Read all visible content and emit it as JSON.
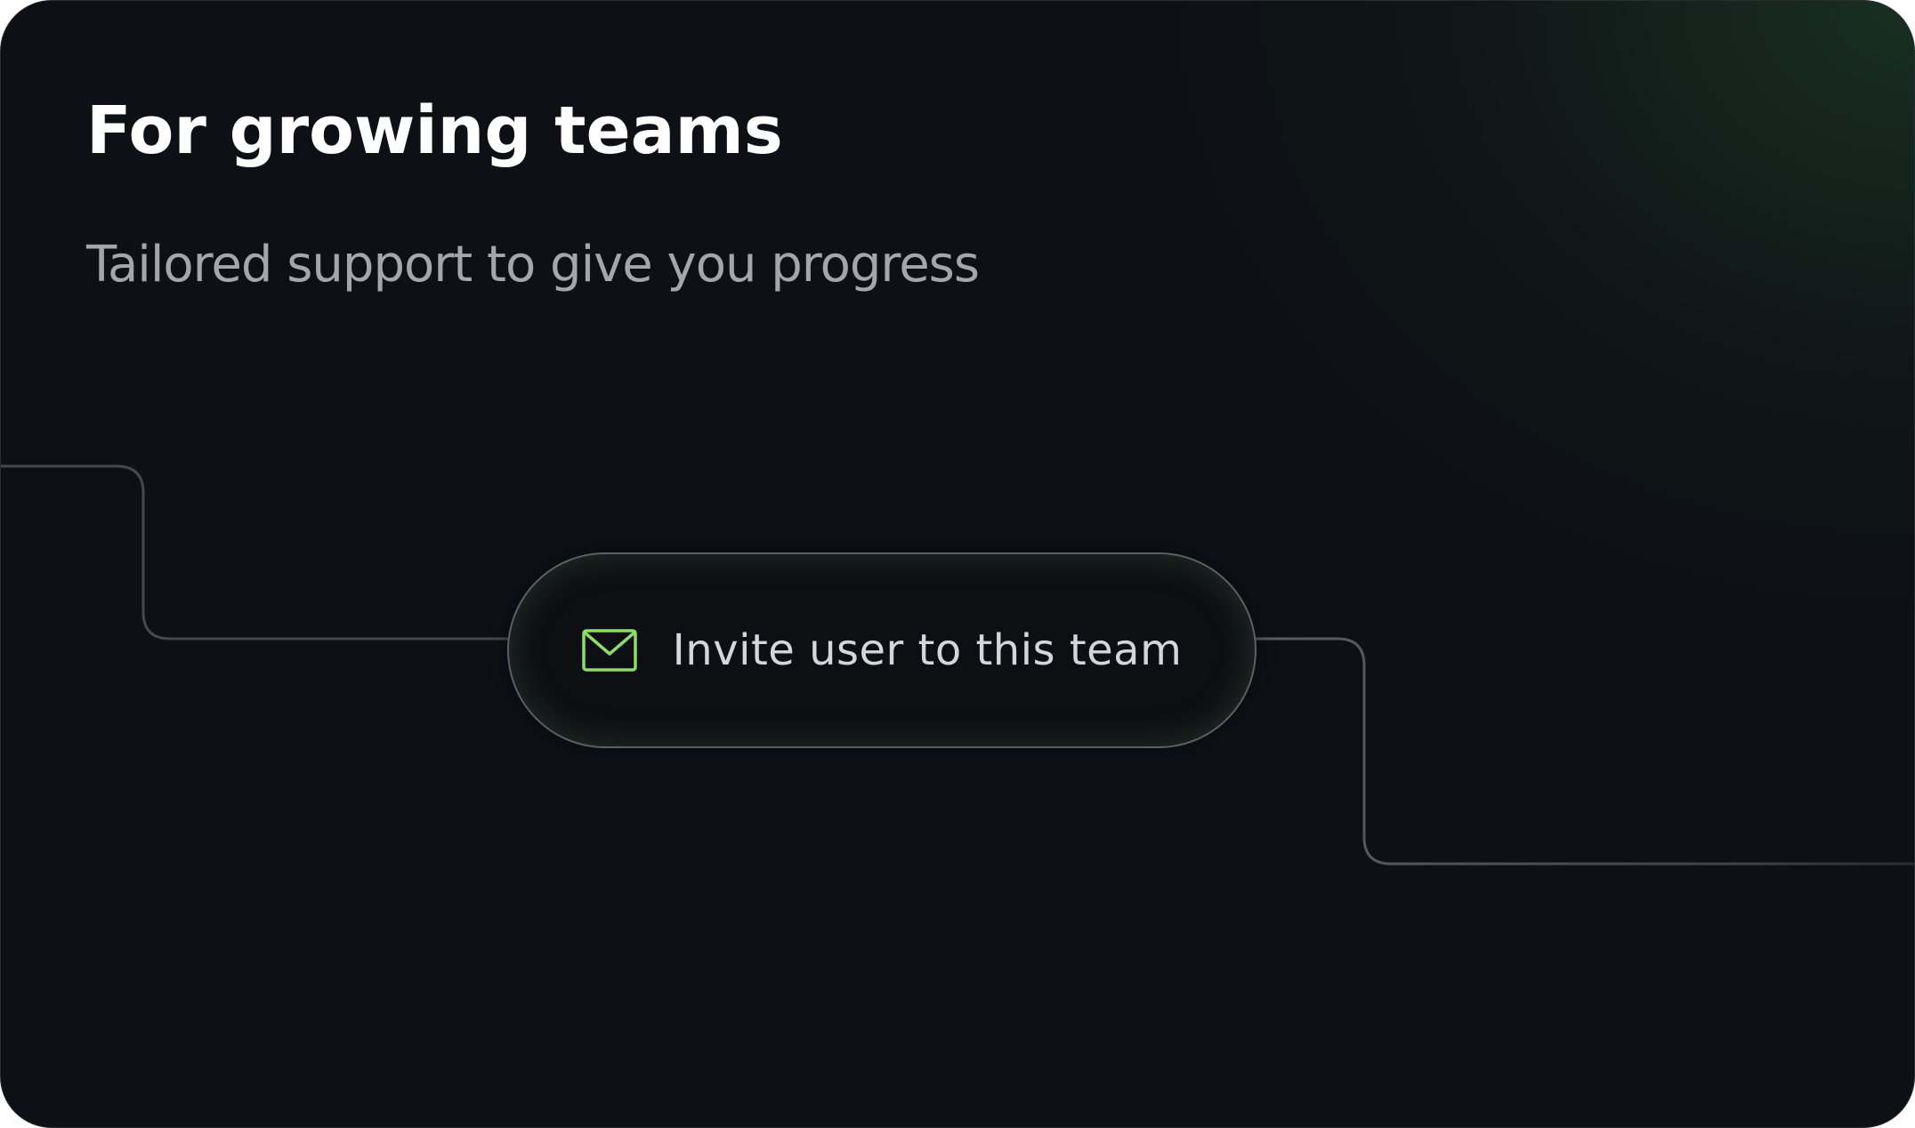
{
  "card": {
    "title": "For growing teams",
    "subtitle": "Tailored support to give you progress"
  },
  "invite": {
    "label": "Invite user to this team",
    "icon": "mail-icon",
    "icon_color": "#8fdc6a"
  },
  "colors": {
    "background": "#0d1015",
    "glow": "#1e3a26",
    "title": "#ffffff",
    "subtitle": "#a3a6ad",
    "connector": "#3f4247",
    "pill_border": "#5b6063"
  }
}
